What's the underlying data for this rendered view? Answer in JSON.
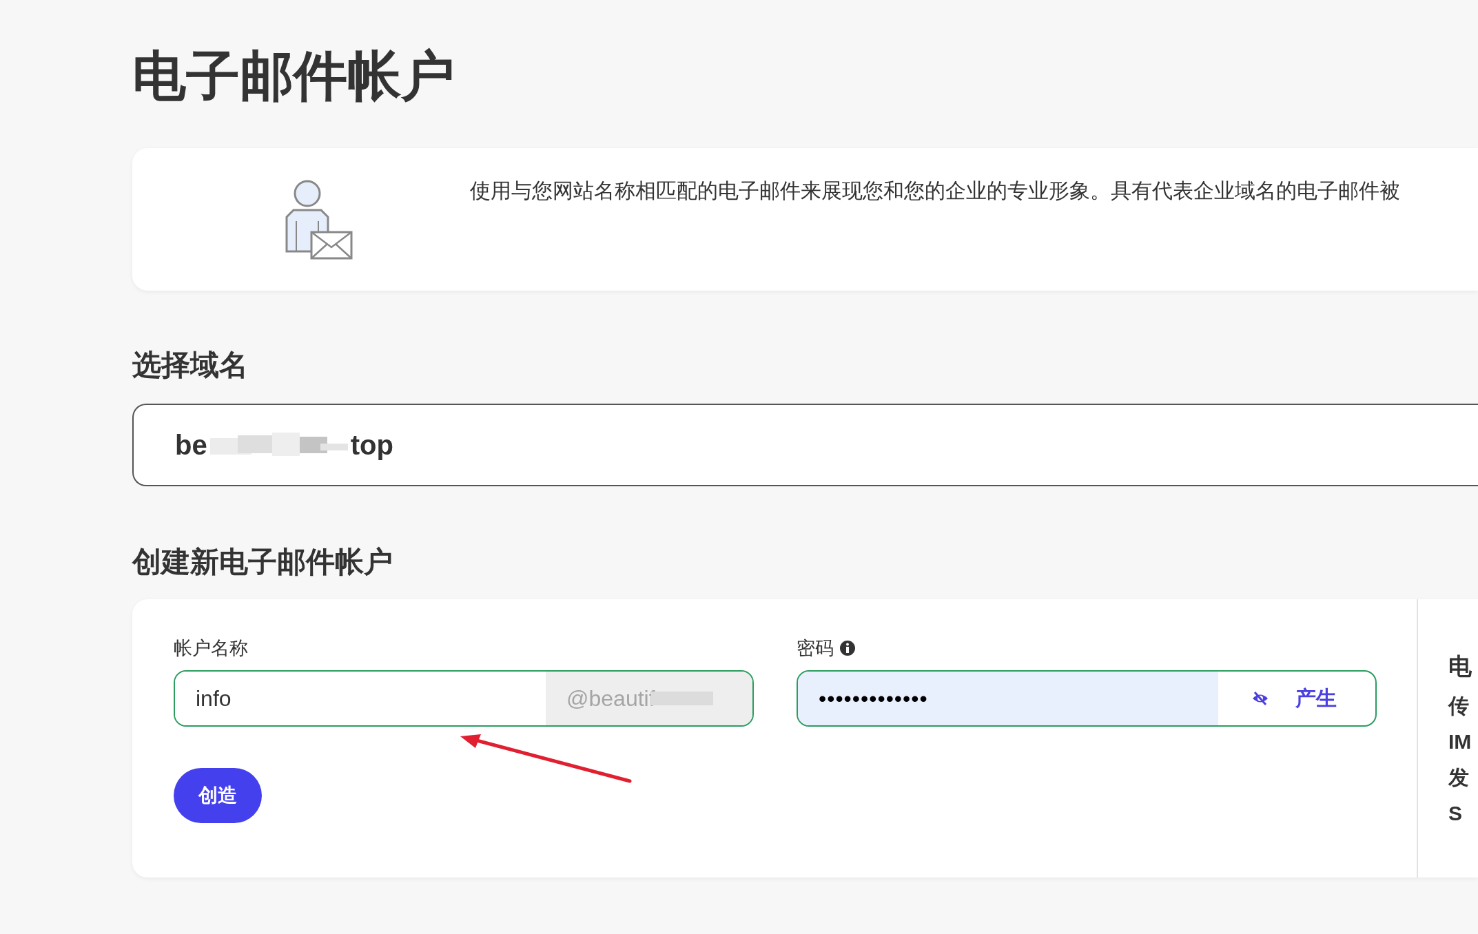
{
  "title": "电子邮件帐户",
  "intro": {
    "text": "使用与您网站名称相匹配的电子邮件来展现您和您的企业的专业形象。具有代表企业域名的电子邮件被"
  },
  "domain_section": {
    "heading": "选择域名",
    "value_start": "be",
    "value_end": "top"
  },
  "create_section": {
    "heading": "创建新电子邮件帐户",
    "account": {
      "label": "帐户名称",
      "value": "info",
      "suffix": "@beautif"
    },
    "password": {
      "label": "密码",
      "value": "•••••••••••••",
      "generate": "产生"
    },
    "submit": "创造",
    "side_lines": [
      "电",
      "传",
      "IM",
      "发",
      "S"
    ]
  }
}
